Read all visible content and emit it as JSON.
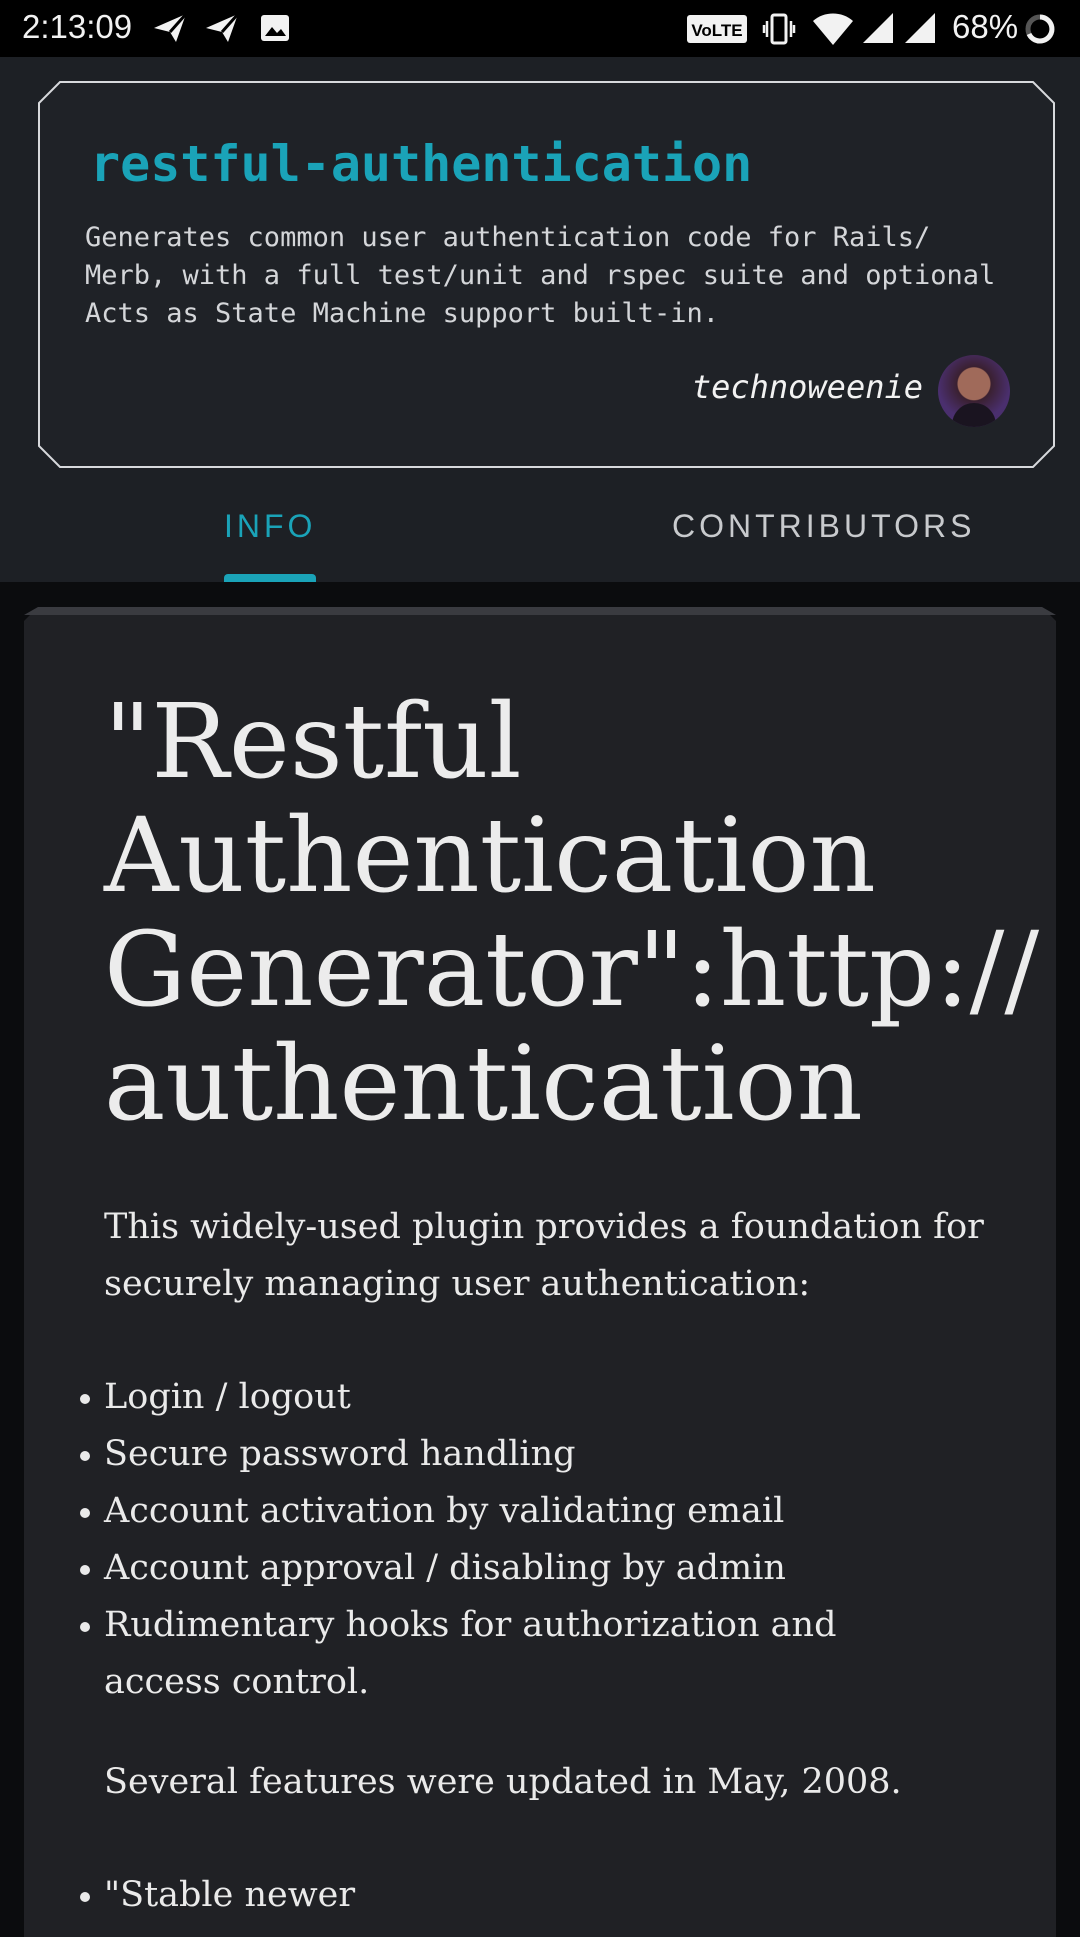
{
  "status_bar": {
    "time": "2:13:09",
    "battery": "68%",
    "icons": [
      "send-icon",
      "send-icon",
      "image-icon",
      "volte-icon",
      "vibrate-icon",
      "wifi-icon",
      "signal-icon",
      "signal-icon",
      "battery-icon"
    ],
    "volte_label": "VoLTE"
  },
  "repo": {
    "name": "restful-authentication",
    "description": "Generates common user authentication code for Rails/ Merb, with a full test/unit and rspec suite and optional Acts as State Machine support built-in.",
    "author": "technoweenie"
  },
  "tabs": [
    {
      "label": "INFO",
      "active": true
    },
    {
      "label": "CONTRIBUTORS",
      "active": false
    }
  ],
  "readme": {
    "title": "\"Restful\nAuthentication\nGenerator\":http://\nauthentication",
    "intro": "This widely-used plugin provides a foundation for securely managing user authentication:",
    "features": [
      "Login / logout",
      "Secure password handling",
      "Account activation by validating email",
      "Account approval / disabling by admin",
      "Rudimentary hooks for authorization and access control."
    ],
    "updated": "Several features were updated in May, 2008.",
    "bottom_items": [
      "\"Stable newer"
    ]
  },
  "colors": {
    "accent": "#1aa3b8",
    "header_bg": "#1d2025",
    "card_bg": "#202125",
    "page_bg": "#0b0c0e"
  }
}
